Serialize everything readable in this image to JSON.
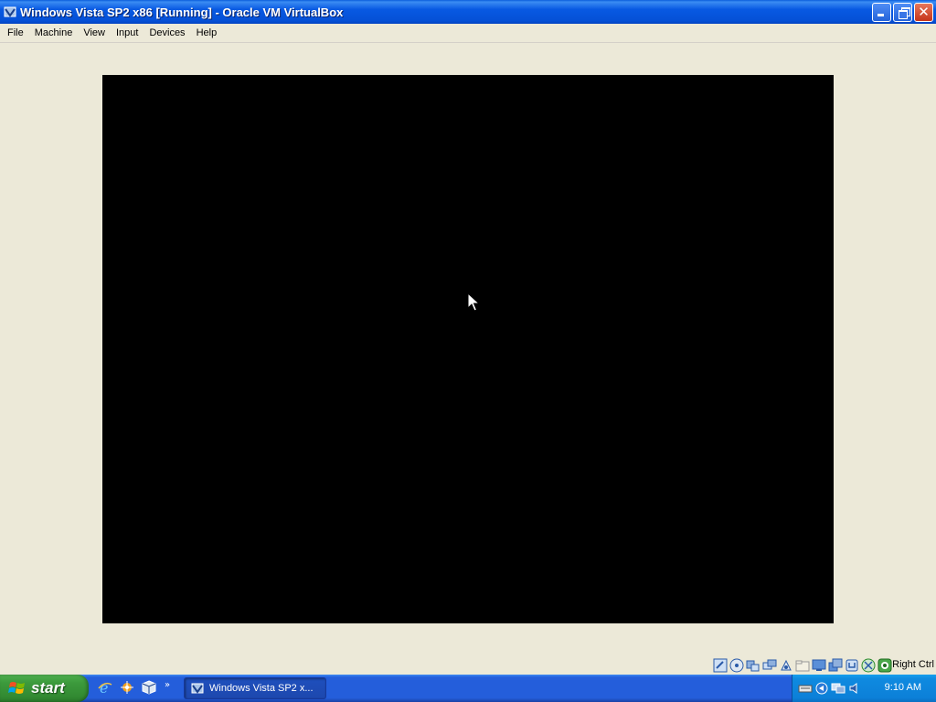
{
  "window": {
    "title": "Windows Vista SP2 x86 [Running] - Oracle VM VirtualBox",
    "icon": "virtualbox-icon"
  },
  "menubar": {
    "items": [
      "File",
      "Machine",
      "View",
      "Input",
      "Devices",
      "Help"
    ]
  },
  "statusbar": {
    "icons": [
      "hard-disk-icon",
      "optical-drive-icon",
      "audio-icon",
      "network-icon",
      "usb-icon",
      "shared-folders-icon",
      "display-icon",
      "video-capture-icon",
      "vrde-icon",
      "virtualization-icon",
      "mouse-integration-icon"
    ],
    "host_key": "Right Ctrl"
  },
  "taskbar": {
    "start_label": "start",
    "quick_launch": [
      "internet-explorer-icon",
      "media-icon",
      "virtualbox-icon"
    ],
    "chevron": "»",
    "task_label": "Windows Vista SP2 x...",
    "tray_icons": [
      "keyboard-icon",
      "network-icon",
      "monitor-icon",
      "speaker-icon"
    ],
    "clock": "9:10 AM"
  },
  "colors": {
    "titlebar": "#0550d6",
    "window_bg": "#ece9d8",
    "guest_screen": "#000000",
    "taskbar": "#245edb",
    "start_button": "#3c9a3c",
    "tray": "#0c80d8"
  }
}
